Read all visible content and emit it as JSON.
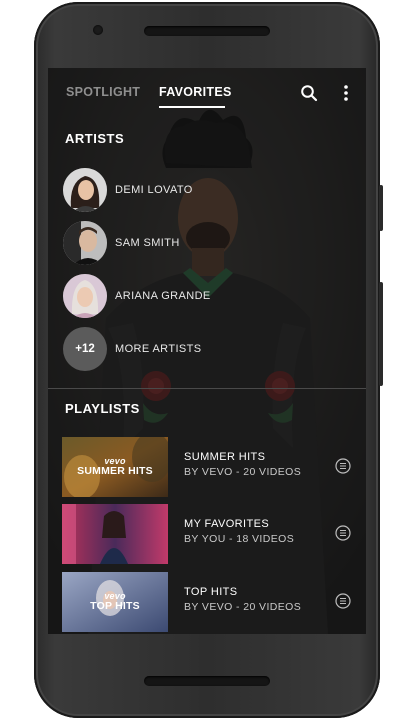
{
  "tabs": [
    {
      "label": "SPOTLIGHT"
    },
    {
      "label": "FAVORITES"
    }
  ],
  "artists_section": {
    "title": "ARTISTS"
  },
  "artists": [
    {
      "name": "DEMI LOVATO"
    },
    {
      "name": "SAM SMITH"
    },
    {
      "name": "ARIANA GRANDE"
    }
  ],
  "more_artists": {
    "count": "+12",
    "label": "MORE ARTISTS"
  },
  "playlists_section": {
    "title": "PLAYLISTS"
  },
  "playlists": [
    {
      "thumb_brand": "vevo",
      "thumb_title": "SUMMER HITS",
      "title": "SUMMER HITS",
      "subtitle": "BY VEVO - 20 VIDEOS"
    },
    {
      "thumb_brand": "",
      "thumb_title": "",
      "title": "MY FAVORITES",
      "subtitle": "BY YOU - 18 VIDEOS"
    },
    {
      "thumb_brand": "vevo",
      "thumb_title": "TOP HITS",
      "title": "TOP HITS",
      "subtitle": "BY VEVO -  20 VIDEOS"
    }
  ],
  "icons": {
    "search": "search-icon",
    "overflow": "more-vert-icon",
    "playlist_menu": "list-menu-icon"
  },
  "colors": {
    "active_tab": "#ffffff",
    "inactive_tab": "#8f8f8f",
    "more_circle": "#5b5b5b"
  }
}
